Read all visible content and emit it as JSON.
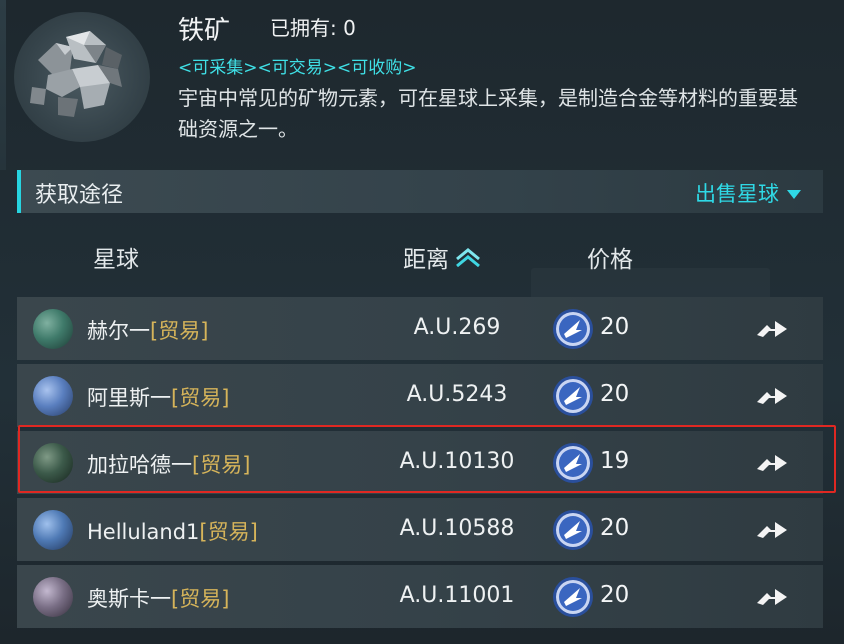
{
  "item": {
    "name": "铁矿",
    "owned_label": "已拥有: 0",
    "tags": "<可采集><可交易><可收购>",
    "description": "宇宙中常见的矿物元素，可在星球上采集，是制造合金等材料的重要基础资源之一。",
    "icon": "iron-ore-icon"
  },
  "acquire": {
    "title": "获取途径",
    "filter_label": "出售星球",
    "filter_icon": "triangle-down-icon"
  },
  "columns": {
    "planet": "星球",
    "distance": "距离",
    "price": "价格",
    "sort_icon": "double-chevron-up-icon"
  },
  "rows": [
    {
      "planet": "赫尔一",
      "tag": "[贸易]",
      "distance": "A.U.269",
      "price": "20",
      "planet_color": "#3f7a6a"
    },
    {
      "planet": "阿里斯一",
      "tag": "[贸易]",
      "distance": "A.U.5243",
      "price": "20",
      "planet_color": "#5a7fbf"
    },
    {
      "planet": "加拉哈德一",
      "tag": "[贸易]",
      "distance": "A.U.10130",
      "price": "19",
      "planet_color": "#3c5a4a"
    },
    {
      "planet": "Helluland1",
      "tag": "[贸易]",
      "distance": "A.U.10588",
      "price": "20",
      "planet_color": "#4f7ab5"
    },
    {
      "planet": "奥斯卡一",
      "tag": "[贸易]",
      "distance": "A.U.11001",
      "price": "20",
      "planet_color": "#7a6f86"
    }
  ],
  "colors": {
    "accent": "#2fd9e6",
    "trade_tag": "#d6b45a",
    "highlight": "#e02822"
  }
}
